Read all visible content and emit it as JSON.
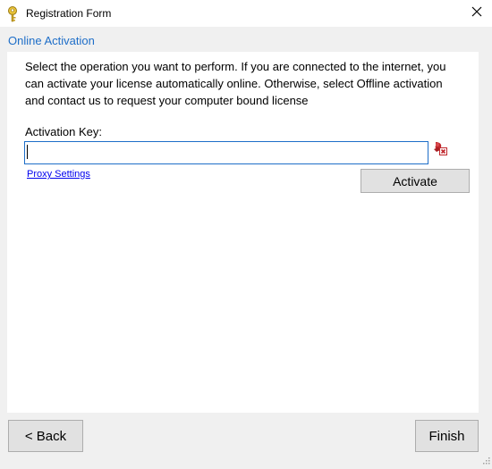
{
  "window": {
    "title": "Registration Form",
    "icons": {
      "app": "key-icon",
      "close": "close-icon"
    }
  },
  "section": {
    "heading": "Online Activation"
  },
  "content": {
    "instructions": "Select the operation you want to perform. If you are connected to the internet, you can activate your license automatically online. Otherwise, select Offline activation and contact us to request your computer bound license",
    "key_label": "Activation Key:",
    "key_value": "",
    "key_placeholder": "",
    "error_icon": "error-icon",
    "proxy_link": "Proxy Settings",
    "activate_label": "Activate"
  },
  "footer": {
    "back_label": "< Back",
    "finish_label": "Finish"
  },
  "colors": {
    "accent": "#1e6ec8",
    "link": "#0000ee",
    "window_bg": "#f0f0f0",
    "panel_bg": "#ffffff",
    "button_bg": "#e1e1e1",
    "button_border": "#adadad",
    "error": "#c0282d"
  }
}
